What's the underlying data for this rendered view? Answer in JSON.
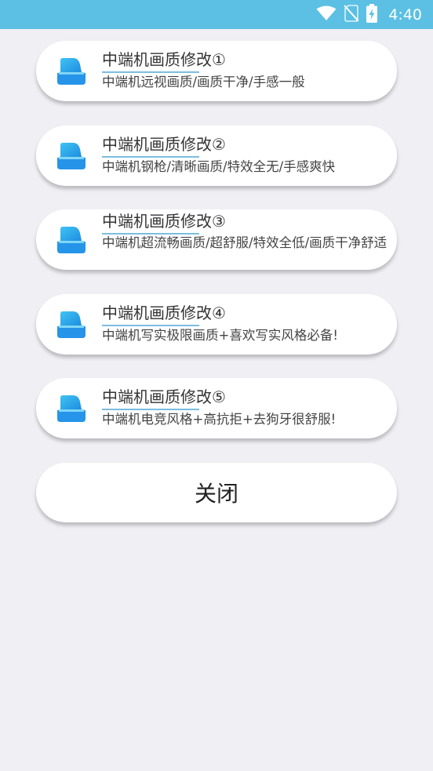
{
  "status_bar": {
    "time": "4:40",
    "background": "#5bc0e3",
    "icons": [
      "wifi-icon",
      "no-sim-icon",
      "battery-charging-icon"
    ]
  },
  "options": [
    {
      "title": "中端机画质修改①",
      "subtitle": "中端机远视画质/画质干净/手感一般"
    },
    {
      "title": "中端机画质修改②",
      "subtitle": "中端机钢枪/清晰画质/特效全无/手感爽快"
    },
    {
      "title": "中端机画质修改③",
      "subtitle": "中端机超流畅画质/超舒服/特效全低/画质干净舒适"
    },
    {
      "title": "中端机画质修改④",
      "subtitle": "中端机写实极限画质+喜欢写实风格必备!"
    },
    {
      "title": "中端机画质修改⑤",
      "subtitle": "中端机电竞风格+高抗拒+去狗牙很舒服!"
    }
  ],
  "close_button": {
    "label": "关闭"
  },
  "colors": {
    "page_background": "#efeff4",
    "card_background": "#ffffff",
    "accent_underline": "#7bbde0",
    "icon_light": "#3fc3f3",
    "icon_dark": "#1f8de0"
  }
}
